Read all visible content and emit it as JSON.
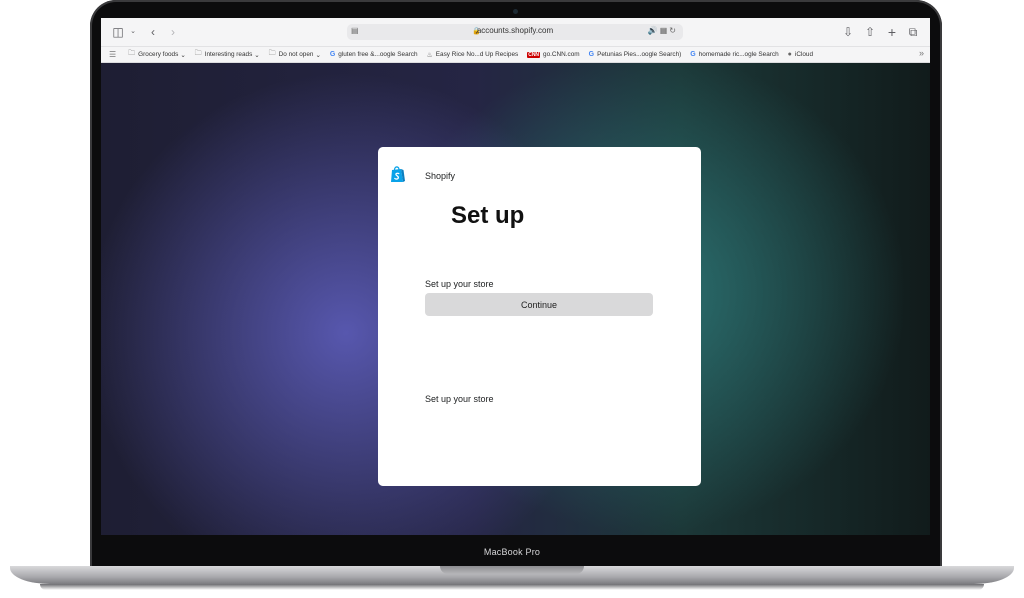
{
  "browser": {
    "url": "accounts.shopify.com",
    "bookmarks": [
      {
        "icon": "folder-icon",
        "label": "Grocery foods",
        "has_menu": true
      },
      {
        "icon": "folder-icon",
        "label": "Interesting reads",
        "has_menu": true
      },
      {
        "icon": "folder-icon",
        "label": "Do not open",
        "has_menu": true
      },
      {
        "icon": "google-icon",
        "label": "gluten free &...oogle Search"
      },
      {
        "icon": "recipe-icon",
        "label": "Easy Rice No...d Up Recipes"
      },
      {
        "icon": "cnn-icon",
        "label": "go.CNN.com"
      },
      {
        "icon": "google-icon",
        "label": "Petunias Pies...oogle Search)"
      },
      {
        "icon": "google-icon",
        "label": "homemade ric...ogle Search"
      },
      {
        "icon": "apple-icon",
        "label": "iCloud"
      }
    ]
  },
  "card": {
    "brand": "Shopify",
    "title": "Set up",
    "section1_label": "Set up your store",
    "continue_label": "Continue",
    "section2_label": "Set up your store"
  },
  "device": {
    "label": "MacBook Pro"
  },
  "colors": {
    "shopify_green": "#95bf47",
    "card_bg": "#ffffff",
    "button_bg": "#d9d9da"
  }
}
